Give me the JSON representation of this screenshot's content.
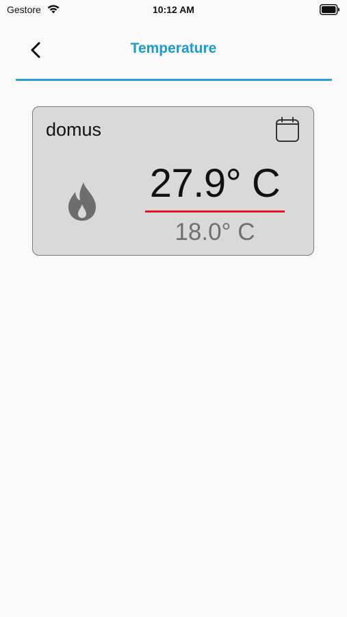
{
  "status_bar": {
    "carrier": "Gestore",
    "time": "10:12 AM",
    "wifi_icon": "wifi-icon",
    "battery_icon": "battery-icon"
  },
  "nav": {
    "title": "Temperature",
    "back_icon": "chevron-left-icon",
    "accent_color": "#1a9bd0"
  },
  "thermostat": {
    "name": "domus",
    "current_temperature": "27.9° C",
    "setpoint_temperature": "18.0° C",
    "mode_icon": "flame-icon",
    "schedule_icon": "calendar-icon",
    "underline_color": "#e2161c"
  }
}
